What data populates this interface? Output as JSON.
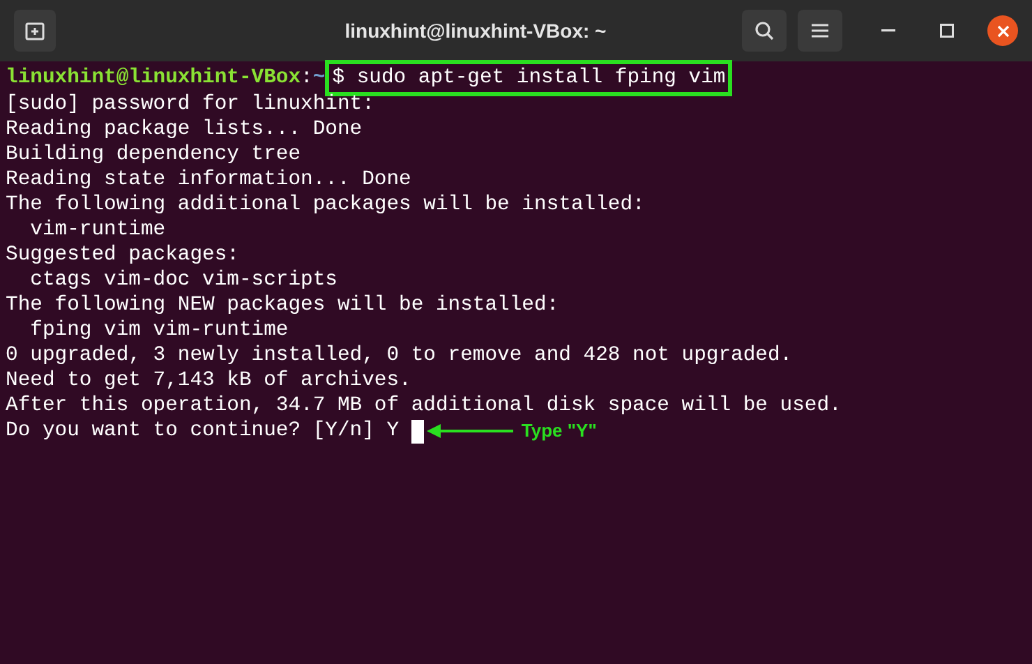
{
  "window": {
    "title": "linuxhint@linuxhint-VBox: ~"
  },
  "prompt": {
    "user_host": "linuxhint@linuxhint-VBox",
    "separator": ":",
    "path": "~",
    "command": "$ sudo apt-get install fping vim"
  },
  "output_lines": [
    "[sudo] password for linuxhint:",
    "Reading package lists... Done",
    "Building dependency tree",
    "Reading state information... Done",
    "The following additional packages will be installed:",
    "  vim-runtime",
    "Suggested packages:",
    "  ctags vim-doc vim-scripts",
    "The following NEW packages will be installed:",
    "  fping vim vim-runtime",
    "0 upgraded, 3 newly installed, 0 to remove and 428 not upgraded.",
    "Need to get 7,143 kB of archives.",
    "After this operation, 34.7 MB of additional disk space will be used."
  ],
  "input_line": {
    "text": "Do you want to continue? [Y/n] Y "
  },
  "annotation": {
    "label": "Type \"Y\""
  }
}
